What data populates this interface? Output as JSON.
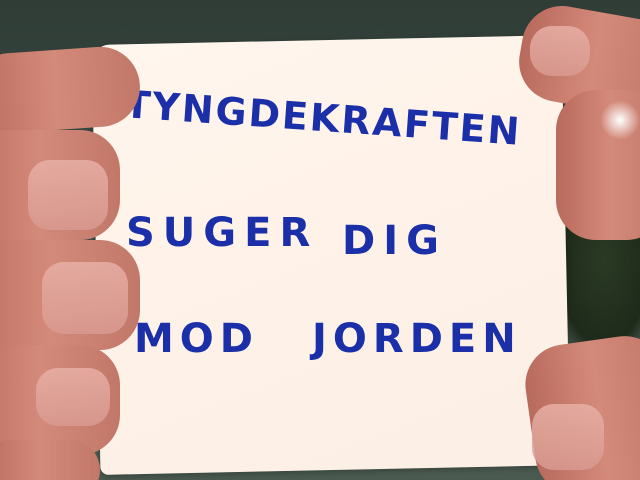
{
  "note": {
    "line1": "TYNGDEKRAFTEN",
    "line2a": "SUGER",
    "line2b": "DIG",
    "line3a": "MOD",
    "line3b": "JORDEN"
  },
  "colors": {
    "ink": "#1a2fa8",
    "paper": "#fff4ea",
    "background": "#34443c",
    "skin": "#c98070"
  }
}
